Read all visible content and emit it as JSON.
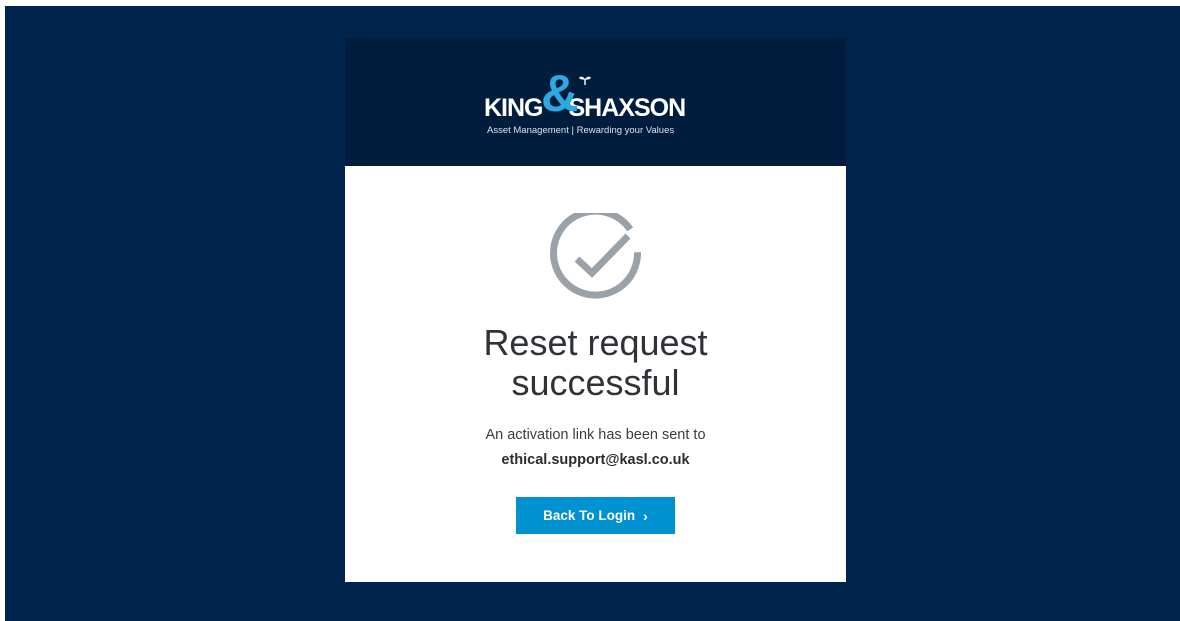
{
  "brand": {
    "name_left": "KING",
    "ampersand": "&",
    "name_right": "SHAXSON",
    "tagline": "Asset Management | Rewarding your Values",
    "colors": {
      "navy": "#00244b",
      "header": "#001d3e",
      "accent": "#2fa8df"
    }
  },
  "status": {
    "icon": "check-circle-icon",
    "icon_color": "#9aa1a9",
    "title_line1": "Reset request",
    "title_line2": "successful",
    "message": "An activation link has been sent to",
    "email": "ethical.support@kasl.co.uk"
  },
  "actions": {
    "back_label": "Back To Login",
    "back_icon": "chevron-right-icon",
    "back_chevron": "›",
    "button_color": "#0091d0"
  }
}
